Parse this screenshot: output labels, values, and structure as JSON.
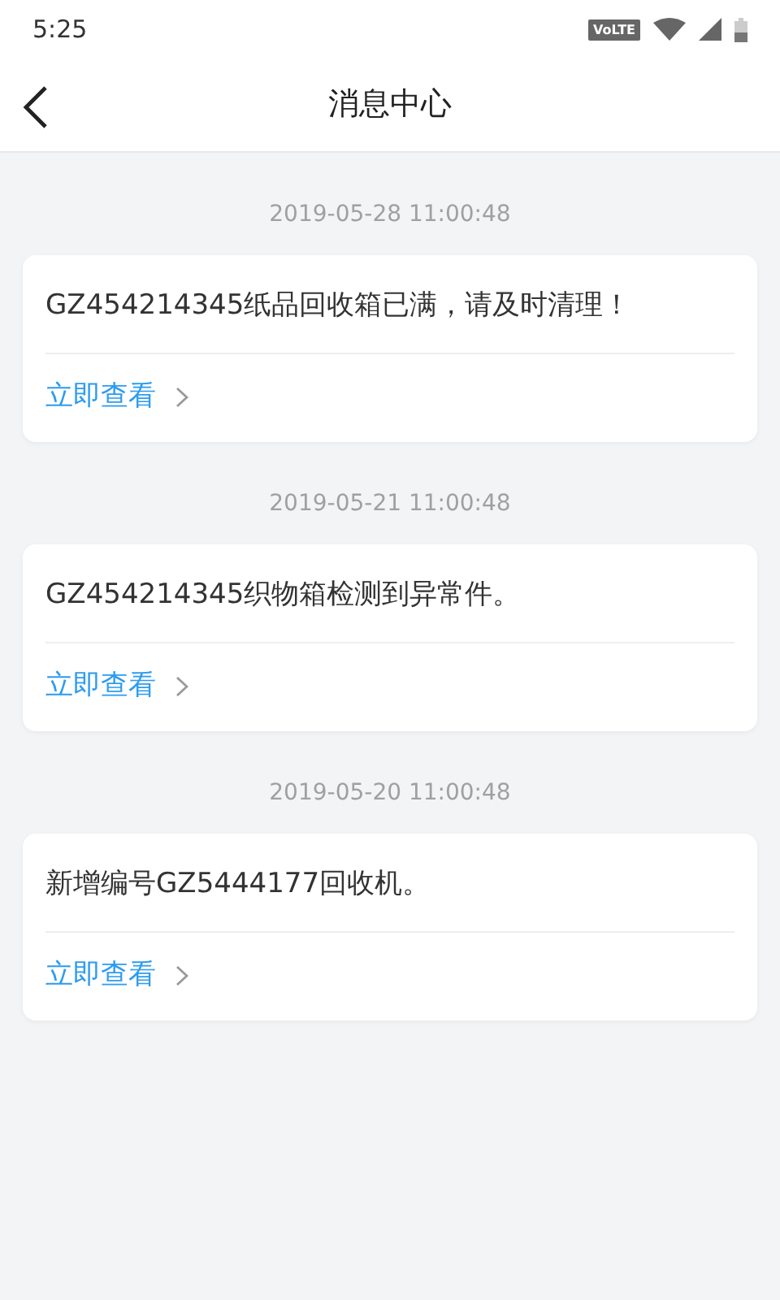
{
  "status_bar": {
    "time": "5:25",
    "network_badge": "VoLTE"
  },
  "header": {
    "title": "消息中心"
  },
  "messages": [
    {
      "time": "2019-05-28 11:00:48",
      "text": "GZ454214345纸品回收箱已满，请及时清理！",
      "action": "立即查看"
    },
    {
      "time": "2019-05-21 11:00:48",
      "text": "GZ454214345织物箱检测到异常件。",
      "action": "立即查看"
    },
    {
      "time": "2019-05-20 11:00:48",
      "text": "新增编号GZ5444177回收机。",
      "action": "立即查看"
    }
  ]
}
